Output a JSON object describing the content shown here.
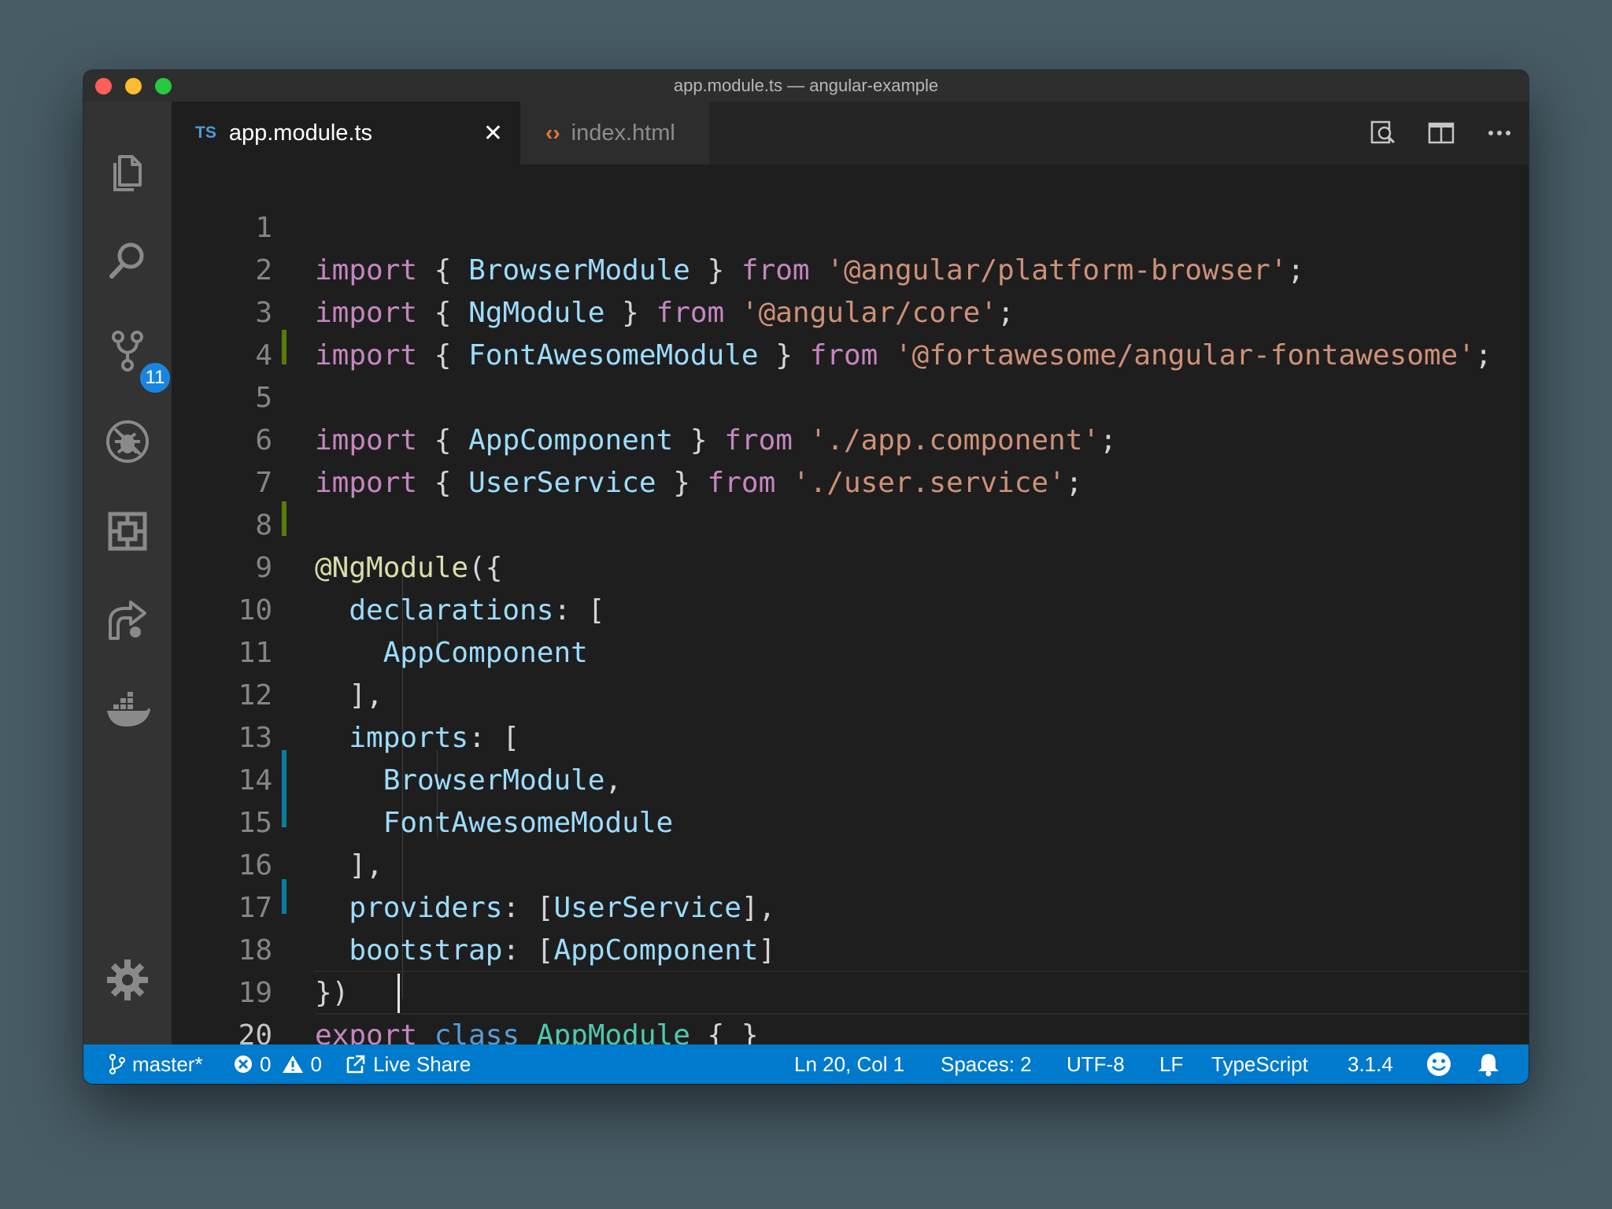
{
  "window": {
    "title": "app.module.ts — angular-example"
  },
  "activity_bar": {
    "items": [
      {
        "icon": "explorer-icon"
      },
      {
        "icon": "search-icon"
      },
      {
        "icon": "source-control-icon",
        "badge": "11"
      },
      {
        "icon": "debug-icon"
      },
      {
        "icon": "extensions-icon"
      },
      {
        "icon": "live-share-icon"
      },
      {
        "icon": "docker-icon"
      }
    ],
    "settings_icon": "gear-icon"
  },
  "tabs": [
    {
      "label": "app.module.ts",
      "lang_badge": "TS",
      "active": true
    },
    {
      "label": "index.html",
      "icon": "html-icon",
      "active": false
    }
  ],
  "editor": {
    "lines": [
      {
        "n": "1"
      },
      {
        "n": "2"
      },
      {
        "n": "3"
      },
      {
        "n": "4"
      },
      {
        "n": "5"
      },
      {
        "n": "6"
      },
      {
        "n": "7"
      },
      {
        "n": "8"
      },
      {
        "n": "9"
      },
      {
        "n": "10"
      },
      {
        "n": "11"
      },
      {
        "n": "12"
      },
      {
        "n": "13"
      },
      {
        "n": "14"
      },
      {
        "n": "15"
      },
      {
        "n": "16"
      },
      {
        "n": "17"
      },
      {
        "n": "18"
      },
      {
        "n": "19"
      },
      {
        "n": "20"
      }
    ],
    "tokens": {
      "import": "import",
      "from": "from",
      "export": "export",
      "class": "class",
      "l1_id": "BrowserModule",
      "l1_str": "'@angular/platform-browser'",
      "l2_id": "NgModule",
      "l2_str": "'@angular/core'",
      "l3_id": "FontAwesomeModule",
      "l3_str": "'@fortawesome/angular-fontawesome'",
      "l5_id": "AppComponent",
      "l5_str": "'./app.component'",
      "l6_id": "UserService",
      "l6_str": "'./user.service'",
      "l8_fn": "@NgModule",
      "l9_id": "declarations",
      "l10_id": "AppComponent",
      "l12_id": "imports",
      "l13_id": "BrowserModule",
      "l14_id": "FontAwesomeModule",
      "l16_id": "providers",
      "l16_val": "UserService",
      "l17_id": "bootstrap",
      "l17_val": "AppComponent",
      "l19_cls": "AppModule"
    }
  },
  "status_bar": {
    "branch": "master*",
    "errors": "0",
    "warnings": "0",
    "live_share": "Live Share",
    "position": "Ln 20, Col 1",
    "spaces": "Spaces: 2",
    "encoding": "UTF-8",
    "eol": "LF",
    "language": "TypeScript",
    "version": "3.1.4"
  },
  "colors": {
    "status_bar": "#007acc",
    "editor_bg": "#1e1e1e",
    "keyword": "#c586c0",
    "string": "#ce9178",
    "identifier": "#9cdcfe"
  }
}
